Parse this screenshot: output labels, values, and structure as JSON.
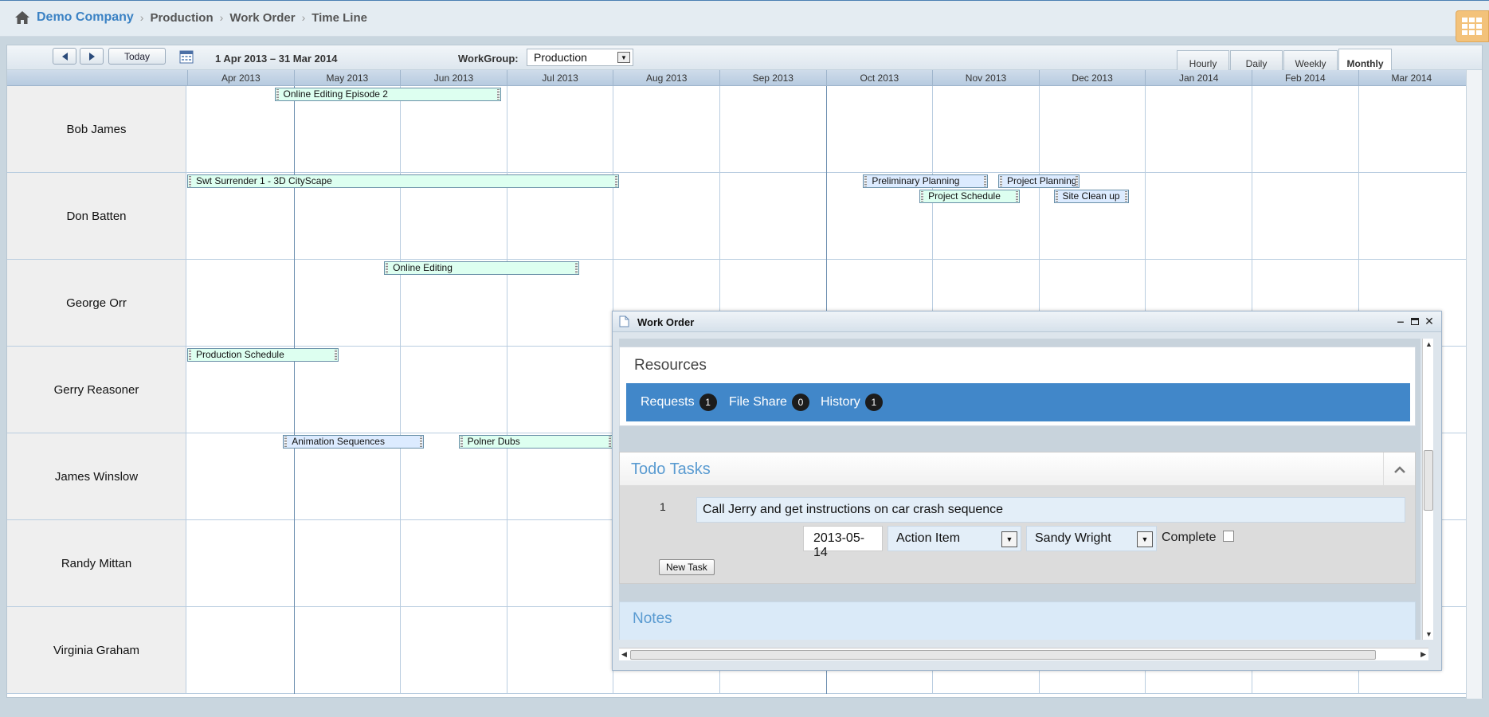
{
  "breadcrumb": {
    "company": "Demo Company",
    "items": [
      "Production",
      "Work Order",
      "Time Line"
    ]
  },
  "toolbar": {
    "today_label": "Today",
    "date_range": "1 Apr 2013 – 31 Mar 2014",
    "workgroup_label": "WorkGroup:",
    "workgroup_value": "Production",
    "views": [
      {
        "label": "Hourly",
        "active": false
      },
      {
        "label": "Daily",
        "active": false
      },
      {
        "label": "Weekly",
        "active": false
      },
      {
        "label": "Monthly",
        "active": true
      }
    ]
  },
  "months": [
    "Apr 2013",
    "May 2013",
    "Jun 2013",
    "Jul 2013",
    "Aug 2013",
    "Sep 2013",
    "Oct 2013",
    "Nov 2013",
    "Dec 2013",
    "Jan 2014",
    "Feb 2014",
    "Mar 2014"
  ],
  "resources": [
    {
      "name": "Bob James",
      "events": [
        {
          "label": "Online Editing Episode 2",
          "start_month": 0.82,
          "end_month": 2.95,
          "lane": 0,
          "style": "green"
        }
      ]
    },
    {
      "name": "Don Batten",
      "events": [
        {
          "label": "Swt Surrender 1 - 3D CityScape",
          "start_month": 0.0,
          "end_month": 4.06,
          "lane": 0,
          "style": "green"
        },
        {
          "label": "Preliminary Planning",
          "start_month": 6.35,
          "end_month": 7.52,
          "lane": 0,
          "style": "blue"
        },
        {
          "label": "Project Planning",
          "start_month": 7.62,
          "end_month": 8.38,
          "lane": 0,
          "style": "blue"
        },
        {
          "label": "Project Schedule",
          "start_month": 6.88,
          "end_month": 7.82,
          "lane": 1,
          "style": "green"
        },
        {
          "label": "Site Clean up",
          "start_month": 8.14,
          "end_month": 8.85,
          "lane": 1,
          "style": "blue"
        }
      ]
    },
    {
      "name": "George Orr",
      "events": [
        {
          "label": "Online Editing",
          "start_month": 1.85,
          "end_month": 3.68,
          "lane": 0,
          "style": "green"
        }
      ]
    },
    {
      "name": "Gerry Reasoner",
      "events": [
        {
          "label": "Production Schedule",
          "start_month": 0.0,
          "end_month": 1.42,
          "lane": 0,
          "style": "green"
        }
      ]
    },
    {
      "name": "James Winslow",
      "events": [
        {
          "label": "Animation Sequences",
          "start_month": 0.9,
          "end_month": 2.22,
          "lane": 0,
          "style": "blue"
        },
        {
          "label": "Polner Dubs",
          "start_month": 2.55,
          "end_month": 4.0,
          "lane": 0,
          "style": "green"
        }
      ]
    },
    {
      "name": "Randy Mittan",
      "events": []
    },
    {
      "name": "Virginia Graham",
      "events": []
    }
  ],
  "dialog": {
    "title": "Work Order",
    "resources_title": "Resources",
    "tabs": [
      {
        "label": "Requests",
        "count": "1"
      },
      {
        "label": "File Share",
        "count": "0"
      },
      {
        "label": "History",
        "count": "1"
      }
    ],
    "todo_title": "Todo Tasks",
    "task": {
      "number": "1",
      "description": "Call Jerry and get instructions on car crash sequence",
      "date": "2013-05-14",
      "type": "Action Item",
      "assignee": "Sandy Wright",
      "complete_label": "Complete"
    },
    "new_task_label": "New Task",
    "notes_title": "Notes"
  },
  "colors": {
    "accent": "#3b82c4",
    "tab_bar": "#4187c9",
    "event_green": "#ddfff0",
    "event_blue": "#dcebff"
  }
}
